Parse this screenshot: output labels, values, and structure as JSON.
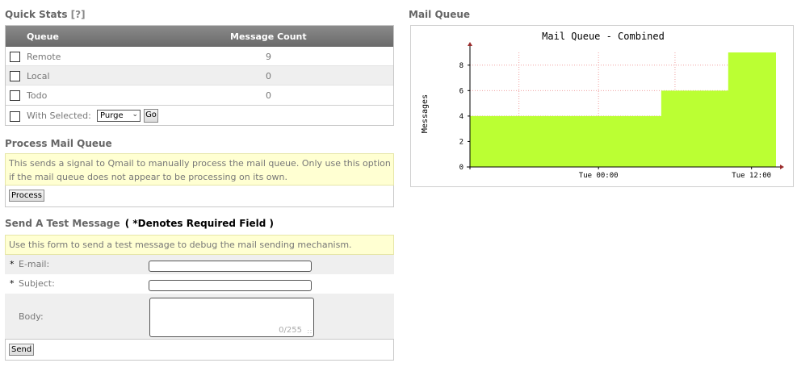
{
  "quick_stats": {
    "title": "Quick Stats",
    "help": "[?]",
    "columns": [
      "Queue",
      "Message Count"
    ],
    "rows": [
      {
        "name": "Remote",
        "count": "9"
      },
      {
        "name": "Local",
        "count": "0"
      },
      {
        "name": "Todo",
        "count": "0"
      }
    ],
    "with_selected_label": "With Selected:",
    "action_select_value": "Purge",
    "go_label": "Go"
  },
  "process": {
    "title": "Process Mail Queue",
    "notice": "This sends a signal to Qmail to manually process the mail queue. Only use this option if the mail queue does not appear to be processing on its own.",
    "button_label": "Process"
  },
  "test_message": {
    "title": "Send A Test Message",
    "required_note": "( *Denotes Required Field )",
    "notice": "Use this form to send a test message to debug the mail sending mechanism.",
    "fields": {
      "email_label": "E-mail:",
      "subject_label": "Subject:",
      "body_label": "Body:",
      "required_marker": "*",
      "body_counter": "0/255"
    },
    "send_label": "Send"
  },
  "mail_queue": {
    "title": "Mail Queue",
    "chart_data": {
      "type": "area",
      "title": "Mail Queue - Combined",
      "ylabel": "Messages",
      "ylim": [
        0,
        9
      ],
      "yticks": [
        0,
        2,
        4,
        6,
        8
      ],
      "xticks": [
        "Tue 00:00",
        "Tue 12:00"
      ],
      "series": [
        {
          "values": [
            4,
            4,
            4,
            4,
            4,
            4,
            4,
            4,
            4,
            4,
            4,
            4,
            4,
            4,
            4,
            4,
            4,
            4,
            4,
            4,
            6,
            6,
            6,
            6,
            6,
            6,
            6,
            9,
            9,
            9,
            9,
            9
          ],
          "color": "#bbff33"
        }
      ],
      "grid": true
    }
  }
}
